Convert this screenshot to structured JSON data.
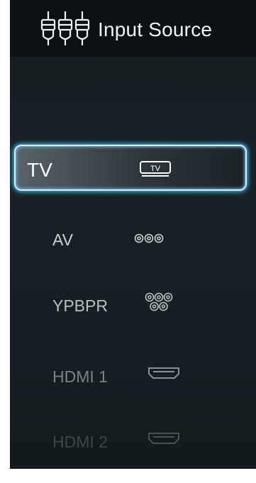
{
  "header": {
    "title": "Input Source",
    "icon": "rca-plugs-icon"
  },
  "sources": [
    {
      "label": "TV",
      "icon": "tv-icon",
      "selected": true
    },
    {
      "label": "AV",
      "icon": "av-jacks-icon",
      "selected": false
    },
    {
      "label": "YPBPR",
      "icon": "component-jacks-icon",
      "selected": false
    },
    {
      "label": "HDMI 1",
      "icon": "hdmi-port-icon",
      "selected": false
    },
    {
      "label": "HDMI 2",
      "icon": "hdmi-port-icon",
      "selected": false
    }
  ],
  "colors": {
    "selection_glow": "#3aa7e6",
    "panel_bg": "#182226",
    "header_bg": "#0d1113"
  }
}
